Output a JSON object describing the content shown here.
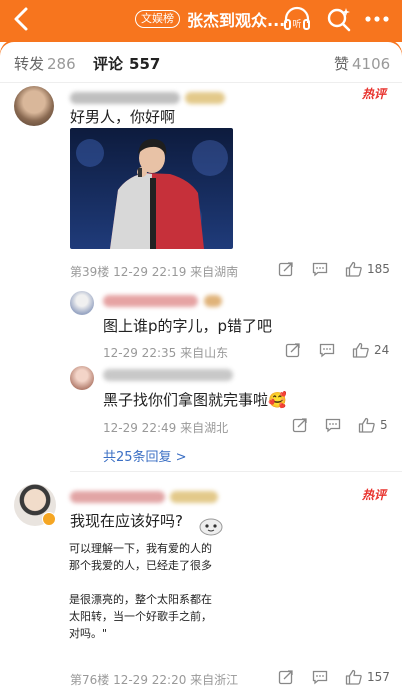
{
  "header": {
    "tag": "文娱榜",
    "title": "张杰到观众...",
    "listen_label": "听"
  },
  "tabs": [
    {
      "label": "转发",
      "count": "286"
    },
    {
      "label": "评论",
      "count": "557"
    },
    {
      "label": "赞",
      "count": "4106"
    }
  ],
  "comments": [
    {
      "hot_badge": "热评",
      "text": "好男人，你好啊",
      "image_caption": "",
      "meta": "第39楼  12-29 22:19  来自湖南",
      "likes": "185",
      "replies": [
        {
          "text": "图上谁p的字儿，p错了吧",
          "meta": "12-29 22:35  来自山东",
          "likes": "24"
        },
        {
          "text": "黑子找你们拿图就完事啦",
          "emoji": "🥰",
          "meta": "12-29 22:49  来自湖北",
          "likes": "5"
        }
      ],
      "more_replies": "共25条回复 >"
    },
    {
      "hot_badge": "热评",
      "text": "我现在应该好吗?",
      "screenshot_lines": [
        "可以理解一下，我有爱的人的",
        "那个我爱的人，已经走了很多",
        "",
        "是很漂亮的，整个太阳系都在",
        "太阳转，当一个好歌手之前，",
        "对吗。\""
      ],
      "meta": "第76楼  12-29 22:20  来自浙江",
      "likes": "157"
    }
  ],
  "colors": {
    "brand": "#f7751e",
    "hot": "#e8322d",
    "link": "#3b6fc4"
  }
}
